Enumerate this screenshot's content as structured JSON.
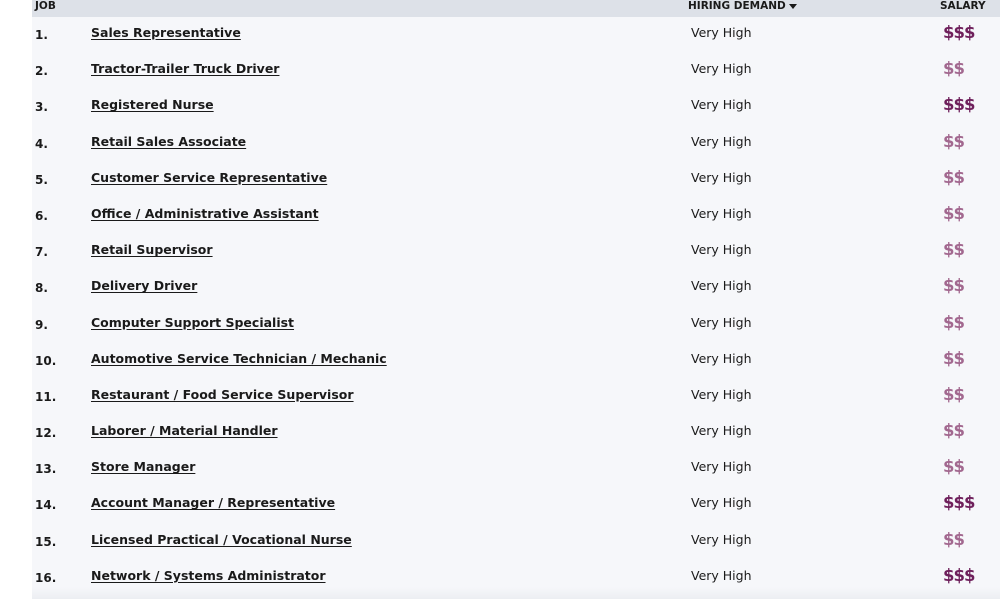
{
  "header": {
    "job": "JOB",
    "hiring_demand": "HIRING DEMAND",
    "salary": "SALARY"
  },
  "colors": {
    "salary_medium": "#a2688f",
    "salary_high": "#6e1f5b",
    "header_bg": "#dde1e8",
    "table_bg": "#f6f7fa"
  },
  "rows": [
    {
      "num": "1.",
      "job": "Sales Representative",
      "demand": "Very High",
      "salary": "$$$"
    },
    {
      "num": "2.",
      "job": "Tractor-Trailer Truck Driver",
      "demand": "Very High",
      "salary": "$$"
    },
    {
      "num": "3.",
      "job": "Registered Nurse",
      "demand": "Very High",
      "salary": "$$$"
    },
    {
      "num": "4.",
      "job": "Retail Sales Associate",
      "demand": "Very High",
      "salary": "$$"
    },
    {
      "num": "5.",
      "job": "Customer Service Representative",
      "demand": "Very High",
      "salary": "$$"
    },
    {
      "num": "6.",
      "job": "Office / Administrative Assistant",
      "demand": "Very High",
      "salary": "$$"
    },
    {
      "num": "7.",
      "job": "Retail Supervisor",
      "demand": "Very High",
      "salary": "$$"
    },
    {
      "num": "8.",
      "job": "Delivery Driver",
      "demand": "Very High",
      "salary": "$$"
    },
    {
      "num": "9.",
      "job": "Computer Support Specialist",
      "demand": "Very High",
      "salary": "$$"
    },
    {
      "num": "10.",
      "job": "Automotive Service Technician / Mechanic",
      "demand": "Very High",
      "salary": "$$"
    },
    {
      "num": "11.",
      "job": "Restaurant / Food Service Supervisor",
      "demand": "Very High",
      "salary": "$$"
    },
    {
      "num": "12.",
      "job": "Laborer / Material Handler",
      "demand": "Very High",
      "salary": "$$"
    },
    {
      "num": "13.",
      "job": "Store Manager",
      "demand": "Very High",
      "salary": "$$"
    },
    {
      "num": "14.",
      "job": "Account Manager / Representative",
      "demand": "Very High",
      "salary": "$$$"
    },
    {
      "num": "15.",
      "job": "Licensed Practical / Vocational Nurse",
      "demand": "Very High",
      "salary": "$$"
    },
    {
      "num": "16.",
      "job": "Network / Systems Administrator",
      "demand": "Very High",
      "salary": "$$$"
    }
  ]
}
